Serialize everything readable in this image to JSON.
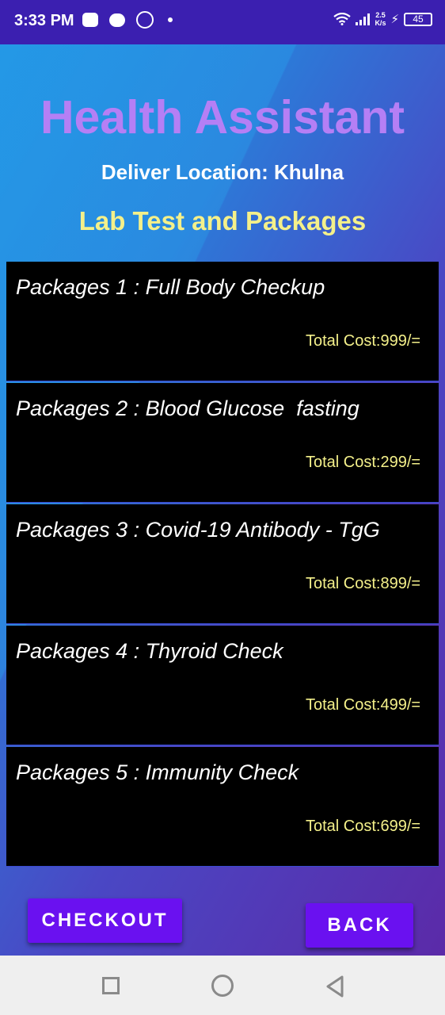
{
  "status_bar": {
    "time": "3:33 PM",
    "net_speed_value": "2.5",
    "net_speed_unit": "K/s",
    "battery": "45"
  },
  "header": {
    "title": "Health Assistant",
    "location": "Deliver Location: Khulna",
    "subtitle": "Lab Test and Packages"
  },
  "packages": [
    {
      "name": "Packages 1 : Full Body Checkup",
      "cost": "Total Cost:999/="
    },
    {
      "name": "Packages 2 : Blood Glucose  fasting",
      "cost": "Total Cost:299/="
    },
    {
      "name": "Packages 3 : Covid-19 Antibody - TgG",
      "cost": "Total Cost:899/="
    },
    {
      "name": "Packages 4 : Thyroid Check",
      "cost": "Total Cost:499/="
    },
    {
      "name": "Packages 5 : Immunity Check",
      "cost": "Total Cost:699/="
    }
  ],
  "buttons": {
    "checkout": "CHECKOUT",
    "back": "BACK"
  },
  "colors": {
    "title": "#b57ff5",
    "subtitle": "#f4f08a",
    "button": "#6a11f0",
    "card_bg": "#000000"
  }
}
